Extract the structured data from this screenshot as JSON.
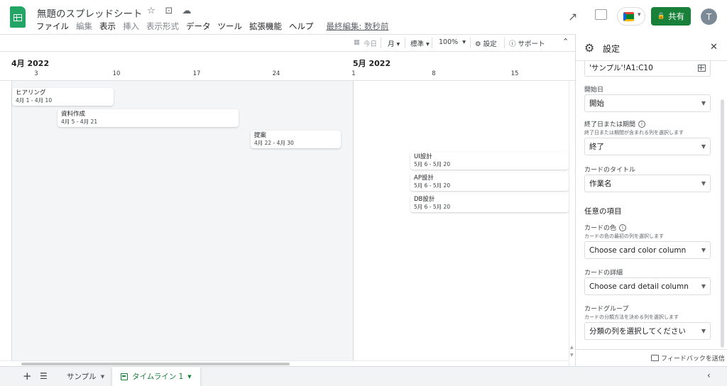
{
  "header": {
    "title": "無題のスプレッドシート",
    "menus": [
      "ファイル",
      "編集",
      "表示",
      "挿入",
      "表示形式",
      "データ",
      "ツール",
      "拡張機能",
      "ヘルプ"
    ],
    "last_edit": "最終編集: 数秒前",
    "share_label": "共有",
    "avatar_initial": "T"
  },
  "toolbar": {
    "today": "今日",
    "scale": "月",
    "density": "標準",
    "zoom": "100%",
    "settings": "設定",
    "support": "サポート"
  },
  "timeline": {
    "months": [
      "4月 2022",
      "5月 2022"
    ],
    "days": [
      "3",
      "10",
      "17",
      "24",
      "1",
      "8",
      "15"
    ],
    "cards": [
      {
        "title": "ヒアリング",
        "dates": "4月 1 - 4月 10"
      },
      {
        "title": "資料作成",
        "dates": "4月 5 - 4月 21"
      },
      {
        "title": "提案",
        "dates": "4月 22 - 4月 30"
      },
      {
        "title": "UI設計",
        "dates": "5月 6 - 5月 20"
      },
      {
        "title": "AP設計",
        "dates": "5月 6 - 5月 20"
      },
      {
        "title": "DB設計",
        "dates": "5月 6 - 5月 20"
      }
    ]
  },
  "panel": {
    "title": "設定",
    "range": "'サンプル'!A1:C10",
    "start_label": "開始日",
    "start_value": "開始",
    "end_label": "終了日または期間",
    "end_hint": "終了日または期間が含まれる列を選択します",
    "end_value": "終了",
    "card_title_label": "カードのタイトル",
    "card_title_value": "作業名",
    "optional_section": "任意の項目",
    "color_label": "カードの色",
    "color_hint": "カードの色の最初の列を選択します",
    "color_value": "Choose card color column",
    "detail_label": "カードの詳細",
    "detail_value": "Choose card detail column",
    "group_label": "カードグループ",
    "group_hint": "カードの分類方法を決める列を選択します",
    "group_value": "分類の列を選択してください",
    "feedback": "フィードバックを送信"
  },
  "sheets": {
    "tabs": [
      "サンプル",
      "タイムライン 1"
    ]
  },
  "colors": {
    "brand_green": "#188038",
    "sheets_logo": "#23a566"
  }
}
